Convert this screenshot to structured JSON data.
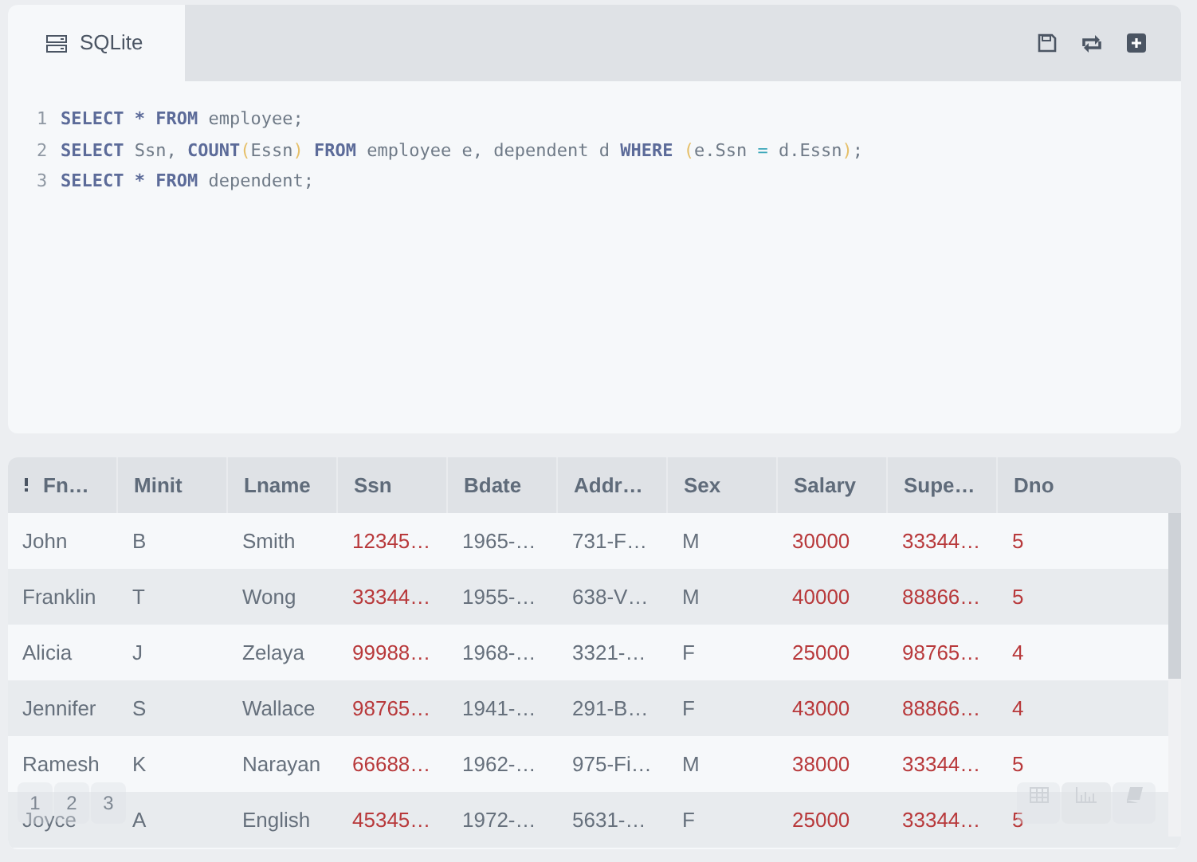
{
  "tab": {
    "label": "SQLite",
    "selected": true
  },
  "editor": {
    "lines": [
      {
        "number": "1",
        "tokens": [
          {
            "kind": "keyword",
            "text": "SELECT * FROM"
          },
          {
            "kind": "plain",
            "text": " employee;"
          }
        ]
      },
      {
        "number": "2",
        "tokens": [
          {
            "kind": "keyword",
            "text": "SELECT"
          },
          {
            "kind": "plain",
            "text": " Ssn, "
          },
          {
            "kind": "keyword",
            "text": "COUNT"
          },
          {
            "kind": "paren",
            "text": "("
          },
          {
            "kind": "plain",
            "text": "Essn"
          },
          {
            "kind": "paren",
            "text": ")"
          },
          {
            "kind": "keyword",
            "text": " FROM"
          },
          {
            "kind": "plain",
            "text": " employee e, dependent d "
          },
          {
            "kind": "keyword",
            "text": "WHERE"
          },
          {
            "kind": "paren",
            "text": " ("
          },
          {
            "kind": "plain",
            "text": "e.Ssn "
          },
          {
            "kind": "operator",
            "text": "="
          },
          {
            "kind": "plain",
            "text": " d.Essn"
          },
          {
            "kind": "paren",
            "text": ")"
          },
          {
            "kind": "plain",
            "text": ";"
          }
        ]
      },
      {
        "number": "3",
        "tokens": [
          {
            "kind": "keyword",
            "text": "SELECT * FROM"
          },
          {
            "kind": "plain",
            "text": " dependent;"
          }
        ]
      }
    ]
  },
  "table": {
    "columns": [
      {
        "label": "Fn…",
        "kind": "text"
      },
      {
        "label": "Minit",
        "kind": "text"
      },
      {
        "label": "Lname",
        "kind": "text"
      },
      {
        "label": "Ssn",
        "kind": "number"
      },
      {
        "label": "Bdate",
        "kind": "text"
      },
      {
        "label": "Addr…",
        "kind": "text"
      },
      {
        "label": "Sex",
        "kind": "text"
      },
      {
        "label": "Salary",
        "kind": "number"
      },
      {
        "label": "Supe…",
        "kind": "number"
      },
      {
        "label": "Dno",
        "kind": "number"
      }
    ],
    "rows": [
      [
        "John",
        "B",
        "Smith",
        "12345…",
        "1965-…",
        "731-F…",
        "M",
        "30000",
        "33344…",
        "5"
      ],
      [
        "Franklin",
        "T",
        "Wong",
        "33344…",
        "1955-…",
        "638-V…",
        "M",
        "40000",
        "88866…",
        "5"
      ],
      [
        "Alicia",
        "J",
        "Zelaya",
        "99988…",
        "1968-…",
        "3321-…",
        "F",
        "25000",
        "98765…",
        "4"
      ],
      [
        "Jennifer",
        "S",
        "Wallace",
        "98765…",
        "1941-…",
        "291-B…",
        "F",
        "43000",
        "88866…",
        "4"
      ],
      [
        "Ramesh",
        "K",
        "Narayan",
        "66688…",
        "1962-…",
        "975-Fi…",
        "M",
        "38000",
        "33344…",
        "5"
      ],
      [
        "Joyce",
        "A",
        "English",
        "45345…",
        "1972-…",
        "5631-…",
        "F",
        "25000",
        "33344…",
        "5"
      ]
    ]
  },
  "pagination": {
    "pages": [
      "1",
      "2",
      "3"
    ]
  }
}
